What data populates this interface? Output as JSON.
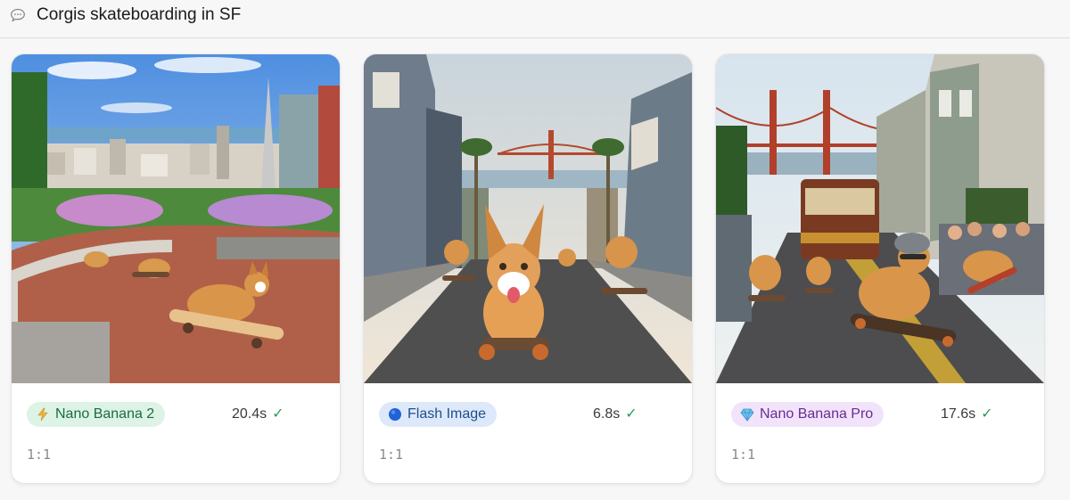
{
  "header": {
    "title": "Corgis skateboarding in SF",
    "icon": "speech-bubble-icon"
  },
  "cards": [
    {
      "model_label": "Nano Banana 2",
      "model_icon": "lightning-icon",
      "badge_bg": "#dcf3e6",
      "badge_fg": "#1e6b3f",
      "time": "20.4s",
      "status_icon": "checkmark-icon",
      "ratio": "1:1",
      "image_alt": "Corgis skateboarding down a brick street with SF skyline and Transamerica Pyramid"
    },
    {
      "model_label": "Flash Image",
      "model_icon": "blue-circle-icon",
      "badge_bg": "#dde9fa",
      "badge_fg": "#1f4e8c",
      "time": "6.8s",
      "status_icon": "checkmark-icon",
      "ratio": "1:1",
      "image_alt": "Corgis skateboarding on a street lined with Victorian houses, Golden Gate Bridge in background"
    },
    {
      "model_label": "Nano Banana Pro",
      "model_icon": "gem-icon",
      "badge_bg": "#f1e4fa",
      "badge_fg": "#6a2b94",
      "time": "17.6s",
      "status_icon": "checkmark-icon",
      "ratio": "1:1",
      "image_alt": "Corgis in helmets skateboarding past a cable car and cheering crowd, Golden Gate Bridge behind"
    }
  ],
  "colors": {
    "check": "#2e9b5a",
    "divider": "#dcdcdc",
    "ratio_text": "#8a8a8a"
  }
}
